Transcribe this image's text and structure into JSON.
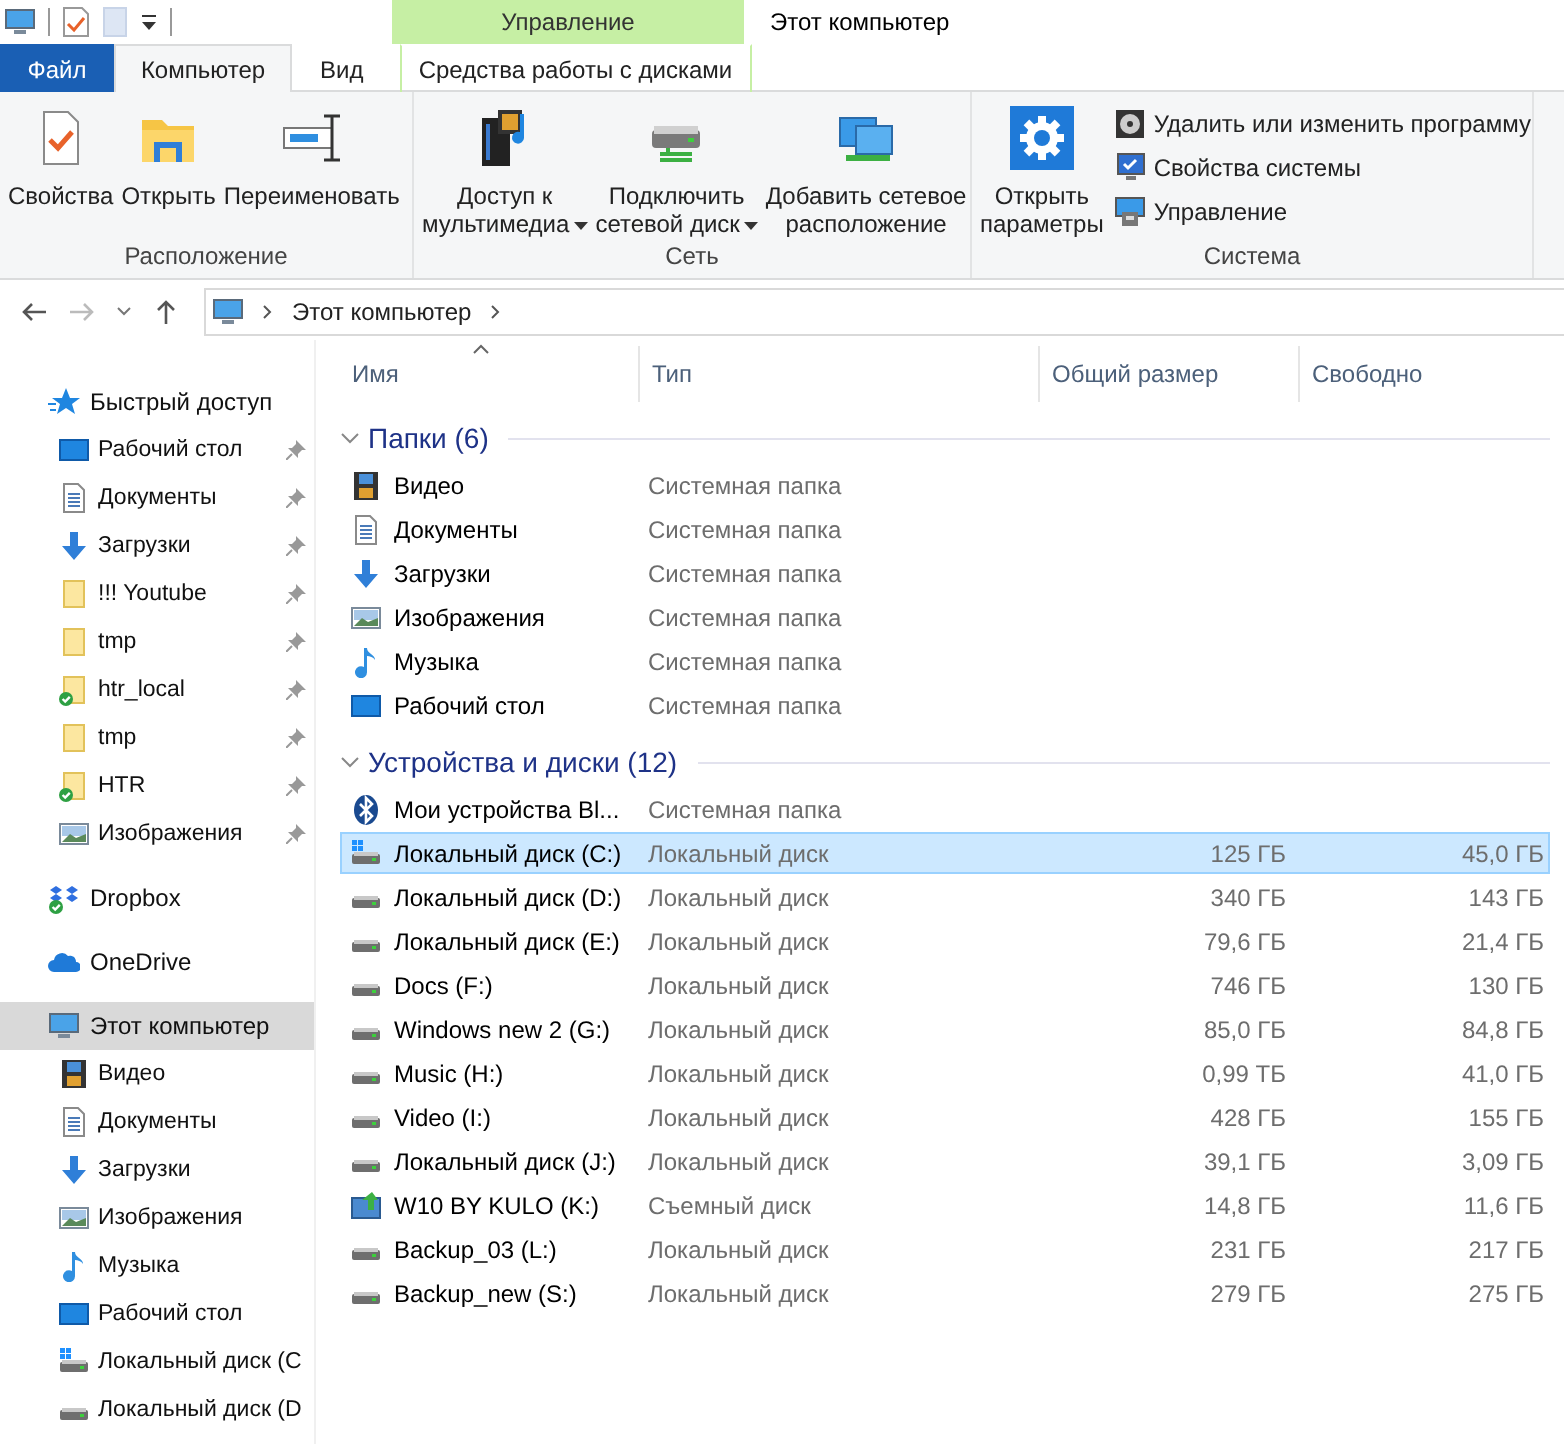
{
  "window": {
    "title": "Этот компьютер",
    "context_group": "Управление"
  },
  "ribbon_tabs": [
    {
      "label": "Файл",
      "kind": "file",
      "selected": false
    },
    {
      "label": "Компьютер",
      "kind": "normal",
      "selected": true
    },
    {
      "label": "Вид",
      "kind": "normal",
      "selected": false
    },
    {
      "label": "Средства работы с дисками",
      "kind": "context",
      "selected": false
    }
  ],
  "ribbon_groups": [
    {
      "label": "Расположение",
      "buttons": [
        {
          "label": "Свойства",
          "kind": "properties",
          "dropdown": false
        },
        {
          "label": "Открыть",
          "kind": "open",
          "dropdown": false
        },
        {
          "label": "Переименовать",
          "kind": "rename",
          "dropdown": false
        }
      ]
    },
    {
      "label": "Сеть",
      "buttons": [
        {
          "label": "Доступ к\nмультимедиа",
          "kind": "media",
          "dropdown": true
        },
        {
          "label": "Подключить\nсетевой диск",
          "kind": "map-drive",
          "dropdown": true
        },
        {
          "label": "Добавить сетевое\nрасположение",
          "kind": "network-location",
          "dropdown": false
        }
      ]
    },
    {
      "label": "Система",
      "buttons": [
        {
          "label": "Открыть\nпараметры",
          "kind": "settings",
          "dropdown": false
        }
      ],
      "small_buttons": [
        {
          "label": "Удалить или изменить программу",
          "kind": "uninstall"
        },
        {
          "label": "Свойства системы",
          "kind": "system-properties"
        },
        {
          "label": "Управление",
          "kind": "manage"
        }
      ]
    }
  ],
  "address": {
    "path": [
      "Этот компьютер"
    ]
  },
  "navigation": [
    {
      "label": "Быстрый доступ",
      "kind": "quick-access",
      "selected": false,
      "children": [
        {
          "label": "Рабочий стол",
          "kind": "desktop",
          "pinned": true,
          "synced": false,
          "selected": false
        },
        {
          "label": "Документы",
          "kind": "documents",
          "pinned": true,
          "synced": false,
          "selected": false
        },
        {
          "label": "Загрузки",
          "kind": "downloads",
          "pinned": true,
          "synced": false,
          "selected": false
        },
        {
          "label": "!!! Youtube",
          "kind": "folder",
          "pinned": true,
          "synced": false,
          "selected": false
        },
        {
          "label": "tmp",
          "kind": "folder",
          "pinned": true,
          "synced": false,
          "selected": false
        },
        {
          "label": "htr_local",
          "kind": "folder",
          "pinned": true,
          "synced": true,
          "selected": false
        },
        {
          "label": "tmp",
          "kind": "folder",
          "pinned": true,
          "synced": false,
          "selected": false
        },
        {
          "label": "HTR",
          "kind": "folder",
          "pinned": true,
          "synced": true,
          "selected": false
        },
        {
          "label": "Изображения",
          "kind": "pictures",
          "pinned": true,
          "synced": false,
          "selected": false
        }
      ]
    },
    {
      "label": "Dropbox",
      "kind": "dropbox",
      "selected": false
    },
    {
      "label": "OneDrive",
      "kind": "onedrive",
      "selected": false
    },
    {
      "label": "Этот компьютер",
      "kind": "computer",
      "selected": true,
      "children": [
        {
          "label": "Видео",
          "kind": "video",
          "pinned": false,
          "synced": false,
          "selected": false
        },
        {
          "label": "Документы",
          "kind": "documents",
          "pinned": false,
          "synced": false,
          "selected": false
        },
        {
          "label": "Загрузки",
          "kind": "downloads",
          "pinned": false,
          "synced": false,
          "selected": false
        },
        {
          "label": "Изображения",
          "kind": "pictures",
          "pinned": false,
          "synced": false,
          "selected": false
        },
        {
          "label": "Музыка",
          "kind": "music",
          "pinned": false,
          "synced": false,
          "selected": false
        },
        {
          "label": "Рабочий стол",
          "kind": "desktop",
          "pinned": false,
          "synced": false,
          "selected": false
        },
        {
          "label": "Локальный диск (C",
          "kind": "system-drive",
          "pinned": false,
          "synced": false,
          "selected": false
        },
        {
          "label": "Локальный диск (D",
          "kind": "drive",
          "pinned": false,
          "synced": false,
          "selected": false
        }
      ]
    }
  ],
  "columns": [
    {
      "label": "Имя",
      "sorted": true
    },
    {
      "label": "Тип",
      "sorted": false
    },
    {
      "label": "Общий размер",
      "sorted": false
    },
    {
      "label": "Свободно",
      "sorted": false
    }
  ],
  "groups": [
    {
      "title": "Папки (6)",
      "expanded": true,
      "items": [
        {
          "name": "Видео",
          "kind": "video",
          "type": "Системная папка",
          "selected": false
        },
        {
          "name": "Документы",
          "kind": "documents",
          "type": "Системная папка",
          "selected": false
        },
        {
          "name": "Загрузки",
          "kind": "downloads",
          "type": "Системная папка",
          "selected": false
        },
        {
          "name": "Изображения",
          "kind": "pictures",
          "type": "Системная папка",
          "selected": false
        },
        {
          "name": "Музыка",
          "kind": "music",
          "type": "Системная папка",
          "selected": false
        },
        {
          "name": "Рабочий стол",
          "kind": "desktop",
          "type": "Системная папка",
          "selected": false
        }
      ]
    },
    {
      "title": "Устройства и диски (12)",
      "expanded": true,
      "items": [
        {
          "name": "Мои устройства Bl...",
          "kind": "bluetooth",
          "type": "Системная папка",
          "selected": false
        },
        {
          "name": "Локальный диск (C:)",
          "kind": "system-drive",
          "type": "Локальный диск",
          "total": "125 ГБ",
          "free": "45,0 ГБ",
          "selected": true
        },
        {
          "name": "Локальный диск (D:)",
          "kind": "drive",
          "type": "Локальный диск",
          "total": "340 ГБ",
          "free": "143 ГБ",
          "selected": false
        },
        {
          "name": "Локальный диск (E:)",
          "kind": "drive",
          "type": "Локальный диск",
          "total": "79,6 ГБ",
          "free": "21,4 ГБ",
          "selected": false
        },
        {
          "name": "Docs (F:)",
          "kind": "drive",
          "type": "Локальный диск",
          "total": "746 ГБ",
          "free": "130 ГБ",
          "selected": false
        },
        {
          "name": "Windows new 2 (G:)",
          "kind": "drive",
          "type": "Локальный диск",
          "total": "85,0 ГБ",
          "free": "84,8 ГБ",
          "selected": false
        },
        {
          "name": "Music (H:)",
          "kind": "drive",
          "type": "Локальный диск",
          "total": "0,99 ТБ",
          "free": "41,0 ГБ",
          "selected": false
        },
        {
          "name": "Video (I:)",
          "kind": "drive",
          "type": "Локальный диск",
          "total": "428 ГБ",
          "free": "155 ГБ",
          "selected": false
        },
        {
          "name": "Локальный диск (J:)",
          "kind": "drive",
          "type": "Локальный диск",
          "total": "39,1 ГБ",
          "free": "3,09 ГБ",
          "selected": false
        },
        {
          "name": "W10 BY KULO (K:)",
          "kind": "usb",
          "type": "Съемный диск",
          "total": "14,8 ГБ",
          "free": "11,6 ГБ",
          "selected": false
        },
        {
          "name": "Backup_03 (L:)",
          "kind": "drive",
          "type": "Локальный диск",
          "total": "231 ГБ",
          "free": "217 ГБ",
          "selected": false
        },
        {
          "name": "Backup_new (S:)",
          "kind": "drive",
          "type": "Локальный диск",
          "total": "279 ГБ",
          "free": "275 ГБ",
          "selected": false
        }
      ]
    }
  ]
}
